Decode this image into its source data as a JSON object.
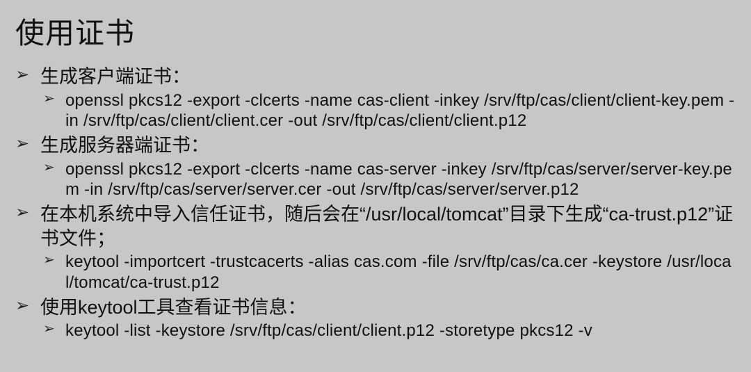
{
  "title": "使用证书",
  "items": [
    {
      "label": "生成客户端证书：",
      "children": [
        "openssl pkcs12 -export -clcerts -name cas-client -inkey /srv/ftp/cas/client/client-key.pem -in /srv/ftp/cas/client/client.cer -out /srv/ftp/cas/client/client.p12"
      ]
    },
    {
      "label": "生成服务器端证书：",
      "children": [
        "openssl pkcs12 -export -clcerts -name cas-server -inkey /srv/ftp/cas/server/server-key.pem  -in /srv/ftp/cas/server/server.cer -out /srv/ftp/cas/server/server.p12"
      ]
    },
    {
      "label": "在本机系统中导入信任证书，随后会在“/usr/local/tomcat”目录下生成“ca-trust.p12”证书文件；",
      "children": [
        "keytool -importcert -trustcacerts -alias cas.com -file /srv/ftp/cas/ca.cer -keystore /usr/local/tomcat/ca-trust.p12"
      ]
    },
    {
      "label": "使用keytool工具查看证书信息：",
      "children": [
        "keytool -list -keystore /srv/ftp/cas/client/client.p12 -storetype pkcs12 -v"
      ]
    }
  ]
}
